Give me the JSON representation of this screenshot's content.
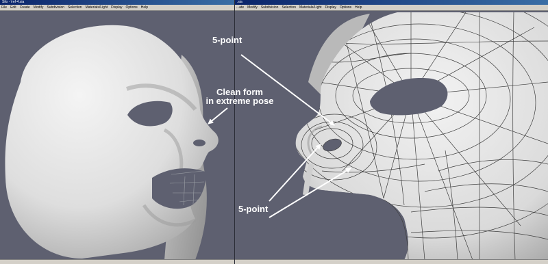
{
  "left_window": {
    "title": "Silo - \\ref-4.sia",
    "menu": [
      "File",
      "Edit",
      "Create",
      "Modify",
      "Subdivision",
      "Selection",
      "Materials/Light",
      "Display",
      "Options",
      "Help"
    ]
  },
  "right_window": {
    "title": ".sia",
    "menu": [
      "...ate",
      "Modify",
      "Subdivision",
      "Selection",
      "Materials/Light",
      "Display",
      "Options",
      "Help"
    ]
  },
  "annotations": {
    "top_label": "5-point",
    "clean_form_line1": "Clean form",
    "clean_form_line2": "in extreme pose",
    "bottom_label": "5-point"
  },
  "colors": {
    "background": "#5e6070",
    "model": "#e4e4e4",
    "wire": "#3d3d3d",
    "annotation": "#ffffff",
    "titlebar": "#0a246a",
    "menubar": "#d4d0c8"
  }
}
